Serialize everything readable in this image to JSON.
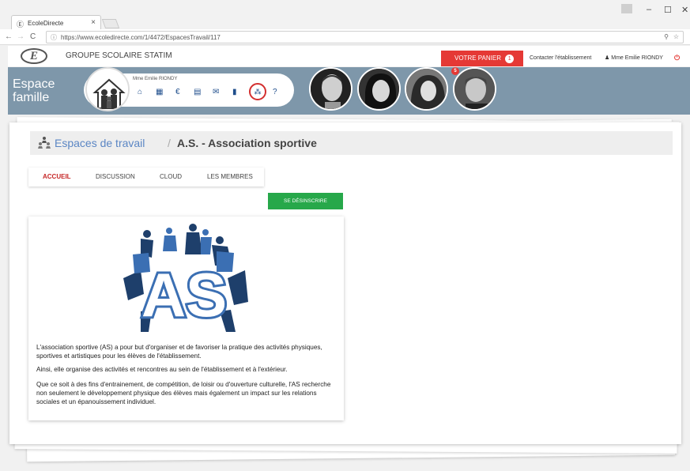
{
  "browser": {
    "tab_title": "EcoleDirecte",
    "tab_close": "×",
    "url": "https://www.ecoledirecte.com/1/4472/EspacesTravail/117",
    "window_controls": [
      "–",
      "☐",
      "✕"
    ]
  },
  "header": {
    "logo_text": "E",
    "school_name": "GROUPE SCOLAIRE STATIM",
    "cart_label": "VOTRE PANIER",
    "cart_count": "1",
    "contact_label": "Contacter l'établissement",
    "user_label": "Mme Emilie RIONDY"
  },
  "banner": {
    "espace_line1": "Espace",
    "espace_line2": "famille",
    "user_name": "Mme Emilie RIONDY",
    "children_badge": "5"
  },
  "breadcrumb": {
    "parent": "Espaces de travail",
    "separator": "/",
    "current": "A.S. - Association sportive"
  },
  "tabs": [
    "ACCUEIL",
    "DISCUSSION",
    "CLOUD",
    "LES MEMBRES"
  ],
  "unsubscribe_label": "SE DÉSINSCRIRE",
  "logo_letters": "AS",
  "paragraphs": [
    "L'association sportive (AS) a pour but d'organiser et de favoriser la pratique des activités physiques, sportives et artistiques pour les élèves de l'établissement.",
    "Ainsi, elle organise des activités et rencontres au sein de l'établissement et à l'extérieur.",
    "Que ce soit à des fins d'entrainement, de compétition, de loisir ou d'ouverture culturelle, l'AS recherche non seulement le développement physique des élèves mais également un impact sur les relations sociales et un épanouissement individuel."
  ],
  "colors": {
    "accent_red": "#e53935",
    "banner": "#7e97aa",
    "link_blue": "#5b86c4",
    "nav_blue": "#1f4e8c",
    "green": "#27a84a"
  }
}
